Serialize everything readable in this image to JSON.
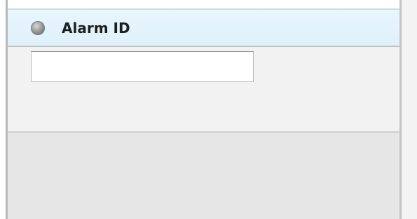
{
  "panel": {
    "title": "Alarm ID",
    "icon": "radio-button-icon",
    "input": {
      "value": "",
      "placeholder": ""
    }
  },
  "colors": {
    "header_bg": "#e2f3fc",
    "body_bg": "#f2f2f2",
    "footer_bg": "#e6e6e6"
  }
}
